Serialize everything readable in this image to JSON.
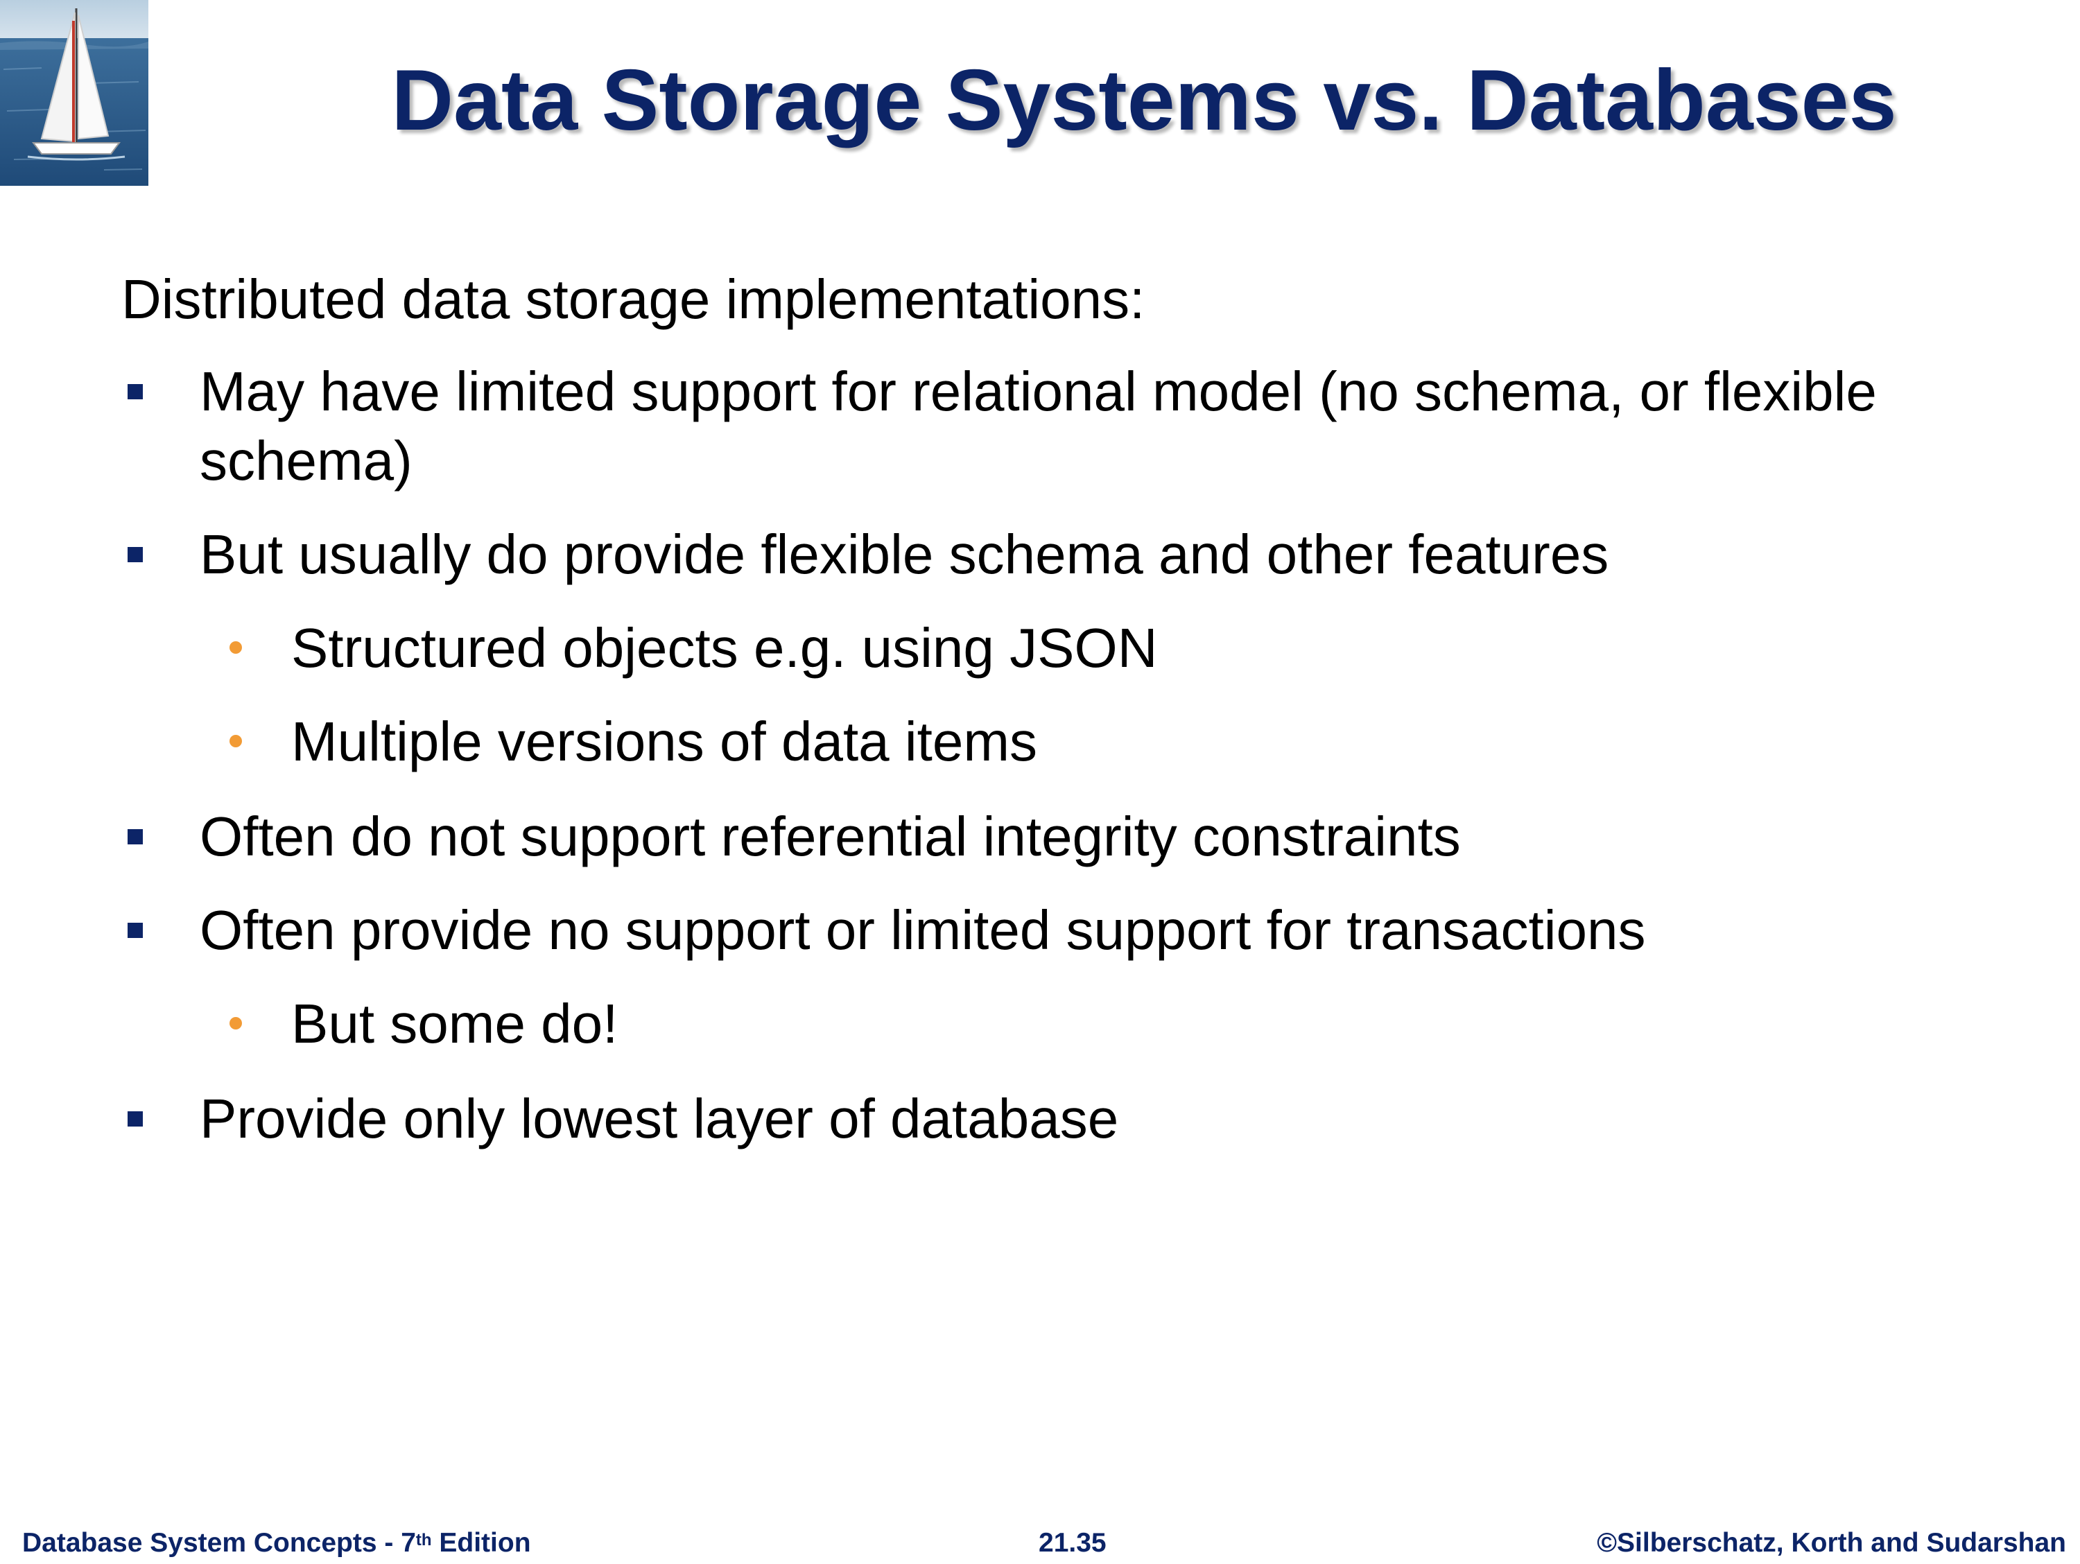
{
  "slide": {
    "title": "Data Storage Systems vs. Databases",
    "intro": "Distributed data storage implementations:",
    "bullets": [
      {
        "text": "May have limited support for relational model (no schema, or flexible schema)"
      },
      {
        "text": "But usually do provide flexible schema and other features"
      },
      {
        "text": "Structured objects e.g. using JSON"
      },
      {
        "text": "Multiple versions of data items"
      },
      {
        "text": "Often do not support referential integrity constraints"
      },
      {
        "text": "Often provide no support or limited support for transactions"
      },
      {
        "text": "But some do!"
      },
      {
        "text": "Provide only lowest layer of database"
      }
    ]
  },
  "footer": {
    "left_prefix": "Database System Concepts - 7",
    "left_sup": "th",
    "left_suffix": " Edition",
    "center": "21.35",
    "right": "©Silberschatz, Korth and Sudarshan"
  },
  "colors": {
    "title": "#0c2467",
    "level1_bullet": "#0c2467",
    "level2_bullet": "#f29b35"
  },
  "icons": {
    "logo": "sailboat-icon",
    "level1_bullet": "square-bullet-icon",
    "level2_bullet": "dot-bullet-icon"
  }
}
